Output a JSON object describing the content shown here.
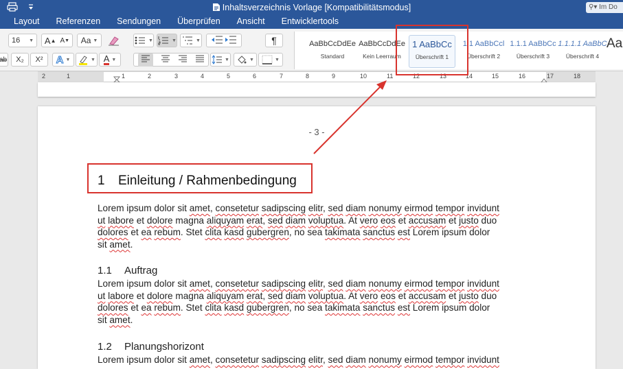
{
  "titlebar": {
    "title": "Inhaltsverzeichnis Vorlage [Kompatibilitätsmodus]",
    "print_icon": "printer-icon",
    "more_icon": "chevron-down-icon",
    "search_text": "Im Do"
  },
  "tabs": [
    "Layout",
    "Referenzen",
    "Sendungen",
    "Überprüfen",
    "Ansicht",
    "Entwicklertools"
  ],
  "ribbon": {
    "font_size": "16",
    "grow_font": "A",
    "shrink_font": "A",
    "case_label": "Aa",
    "sub_label": "X₂",
    "sup_label": "X²",
    "font_color_label": "A",
    "text_effects_label": "A",
    "pilcrow": "¶"
  },
  "styles": [
    {
      "preview": "AaBbCcDdEe",
      "name": "Standard"
    },
    {
      "preview": "AaBbCcDdEe",
      "name": "Kein Leerraum"
    },
    {
      "preview": "1  AaBbCc",
      "name": "Überschrift 1"
    },
    {
      "preview": "1.1  AaBbCcl",
      "name": "Überschrift 2"
    },
    {
      "preview": "1.1.1  AaBbCc",
      "name": "Überschrift 3"
    },
    {
      "preview": "1.1.1.1  AaBbC",
      "name": "Überschrift 4"
    },
    {
      "preview": "Aa",
      "name": ""
    }
  ],
  "ruler": [
    "2",
    "1",
    "1",
    "2",
    "3",
    "4",
    "5",
    "6",
    "7",
    "8",
    "9",
    "10",
    "11",
    "12",
    "13",
    "14",
    "15",
    "16",
    "17",
    "18"
  ],
  "document": {
    "page_number": "- 3 -",
    "h1": {
      "num": "1",
      "text": "Einleitung / Rahmenbedingung"
    },
    "h2_1": {
      "num": "1.1",
      "text": "Auftrag"
    },
    "h2_2": {
      "num": "1.2",
      "text": "Planungshorizont"
    },
    "para_lines": [
      "Lorem ipsum dolor sit amet, consetetur sadipscing elitr, sed diam nonumy eirmod tempor invidunt",
      "ut labore et dolore magna aliquyam erat, sed diam voluptua. At vero eos et accusam et justo duo",
      "dolores et ea rebum. Stet clita kasd gubergren, no sea takimata sanctus est Lorem ipsum dolor",
      "sit amet."
    ],
    "para3_line1": "Lorem ipsum dolor sit amet, consetetur sadipscing elitr, sed diam nonumy eirmod tempor invidunt"
  },
  "colors": {
    "accent": "#2b579a",
    "annotation": "#d8332d",
    "spell": "#d33"
  }
}
